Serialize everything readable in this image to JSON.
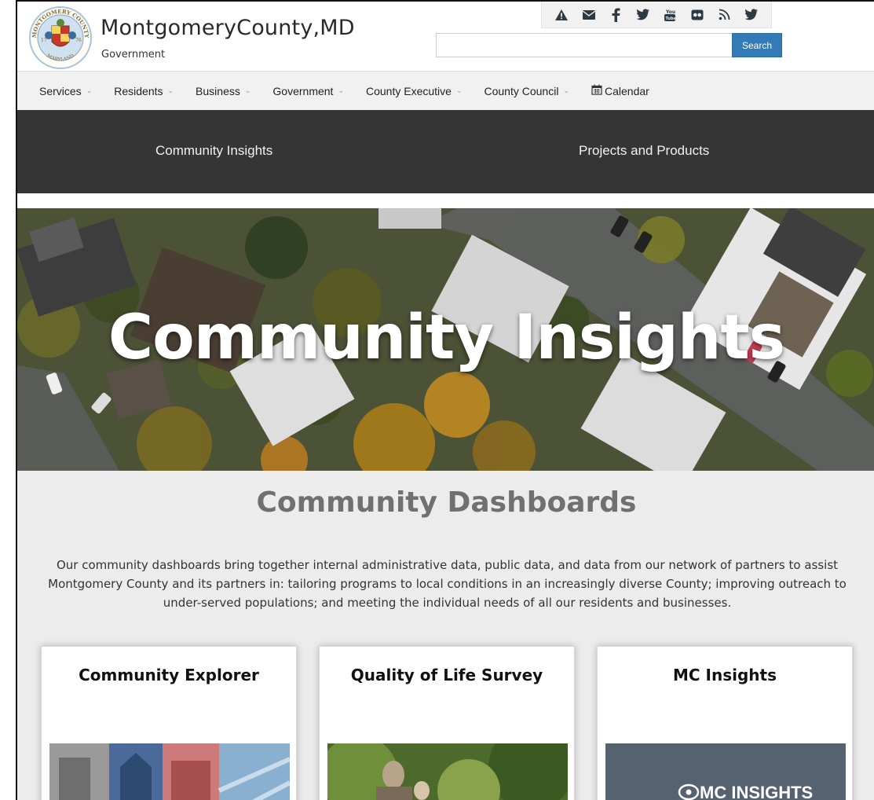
{
  "header": {
    "brand_name": "MontgomeryCounty,MD",
    "brand_sub": "Government",
    "seal_text_top": "MONTGOMERY COUNTY",
    "seal_text_bottom": "MARYLAND",
    "seal_year_left": "17",
    "seal_year_right": "76",
    "social_icons": [
      "alert-icon",
      "email-icon",
      "facebook-icon",
      "twitter-icon",
      "youtube-icon",
      "flickr-icon",
      "rss-icon",
      "twitter-icon"
    ],
    "search": {
      "placeholder": "",
      "value": "",
      "button_label": "Search"
    }
  },
  "nav": {
    "items": [
      {
        "label": "Services",
        "dropdown": true
      },
      {
        "label": "Residents",
        "dropdown": true
      },
      {
        "label": "Business",
        "dropdown": true
      },
      {
        "label": "Government",
        "dropdown": true
      },
      {
        "label": "County Executive",
        "dropdown": true
      },
      {
        "label": "County Council",
        "dropdown": true
      },
      {
        "label": "Calendar",
        "dropdown": false,
        "icon": "calendar-icon"
      }
    ]
  },
  "subnav": {
    "items": [
      {
        "label": "Community Insights"
      },
      {
        "label": "Projects and Products"
      }
    ]
  },
  "hero": {
    "title": "Community Insights"
  },
  "dashboards": {
    "title": "Community Dashboards",
    "description": "Our community dashboards bring together internal administrative data, public data, and data from our network of partners to assist Montgomery County and its partners in: tailoring programs to local conditions in an increasingly diverse County; improving outreach to under-served populations; and meeting the individual needs of all our residents and businesses.",
    "cards": [
      {
        "title": "Community Explorer"
      },
      {
        "title": "Quality of Life Survey"
      },
      {
        "title": "MC Insights",
        "logo_text": "MC INSIGHTS"
      }
    ]
  },
  "colors": {
    "search_button": "#337ab7",
    "subnav_bg": "#353535",
    "nav_bg": "#f1f1f1",
    "content_bg": "#ececec",
    "dash_title": "#707070"
  }
}
